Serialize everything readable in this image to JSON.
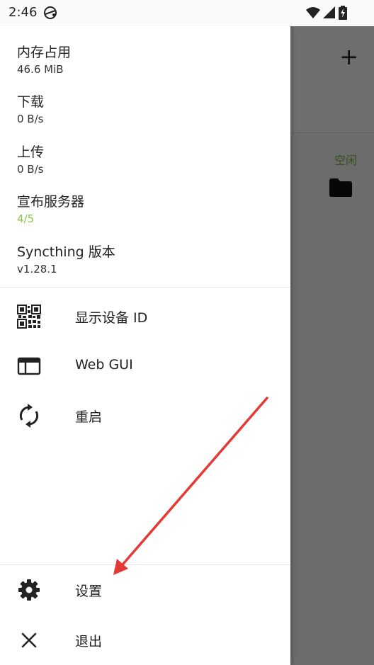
{
  "status_bar": {
    "time": "2:46",
    "icons": [
      "sync-app-icon",
      "wifi-icon",
      "signal-icon",
      "battery-charging-icon"
    ]
  },
  "drawer": {
    "info": [
      {
        "label": "内存占用",
        "value": "46.6 MiB"
      },
      {
        "label": "下载",
        "value": "0 B/s"
      },
      {
        "label": "上传",
        "value": "0 B/s"
      },
      {
        "label": "宣布服务器",
        "value": "4/5",
        "value_color": "#8bc34a"
      },
      {
        "label": "Syncthing 版本",
        "value": "v1.28.1"
      }
    ],
    "menu": [
      {
        "label": "显示设备 ID",
        "icon": "qr-code-icon"
      },
      {
        "label": "Web GUI",
        "icon": "web-window-icon"
      },
      {
        "label": "重启",
        "icon": "restart-icon"
      }
    ],
    "bottom_menu": [
      {
        "label": "设置",
        "icon": "gear-icon"
      },
      {
        "label": "退出",
        "icon": "close-icon"
      }
    ]
  },
  "background_app": {
    "add_icon": "plus-icon",
    "folder_status": "空闲",
    "folder_icon": "folder-icon"
  },
  "annotation": {
    "color": "#e53935",
    "icon": "red-arrow-pointing-to-settings"
  }
}
